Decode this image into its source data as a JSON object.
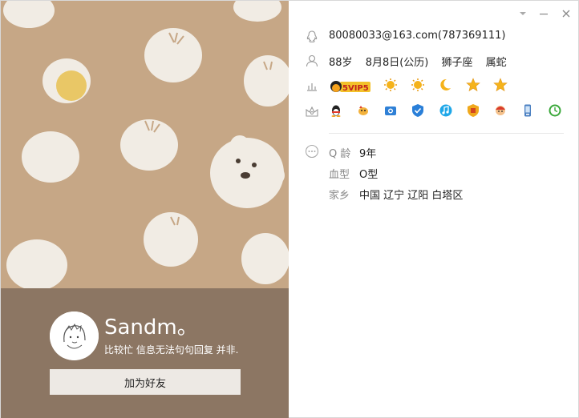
{
  "window": {
    "menu_icon": "chevron-down-icon",
    "minimize_icon": "minimize-icon",
    "close_icon": "close-icon"
  },
  "profile": {
    "nickname": "Sandm。",
    "signature": "比较忙 信息无法句句回复 并非.",
    "add_friend_label": "加为好友"
  },
  "contact": {
    "account": "80080033@163.com(787369111)",
    "age": "88岁",
    "birthday": "8月8日(公历)",
    "zodiac": "狮子座",
    "chinese_zodiac": "属蛇"
  },
  "level": {
    "vip_badge": "5VIP5",
    "icons": [
      "sun-icon",
      "sun-icon",
      "moon-icon",
      "star-icon",
      "star-icon"
    ]
  },
  "services": {
    "icons": [
      "qq-penguin-icon",
      "pet-icon",
      "photo-icon",
      "security-shield-icon",
      "music-icon",
      "game-shield-icon",
      "avatar-show-icon",
      "mobile-icon",
      "clock-icon"
    ]
  },
  "details": {
    "qq_age_label": "Q 龄",
    "qq_age_value": "9年",
    "blood_label": "血型",
    "blood_value": "O型",
    "hometown_label": "家乡",
    "hometown_value": "中国 辽宁 辽阳 白塔区"
  },
  "colors": {
    "wallpaper": "#c6a786",
    "profile_bar": "#8c7663",
    "bun": "#f1ece4",
    "egg_yolk": "#e9c766",
    "button_bg": "#ede9e4"
  }
}
